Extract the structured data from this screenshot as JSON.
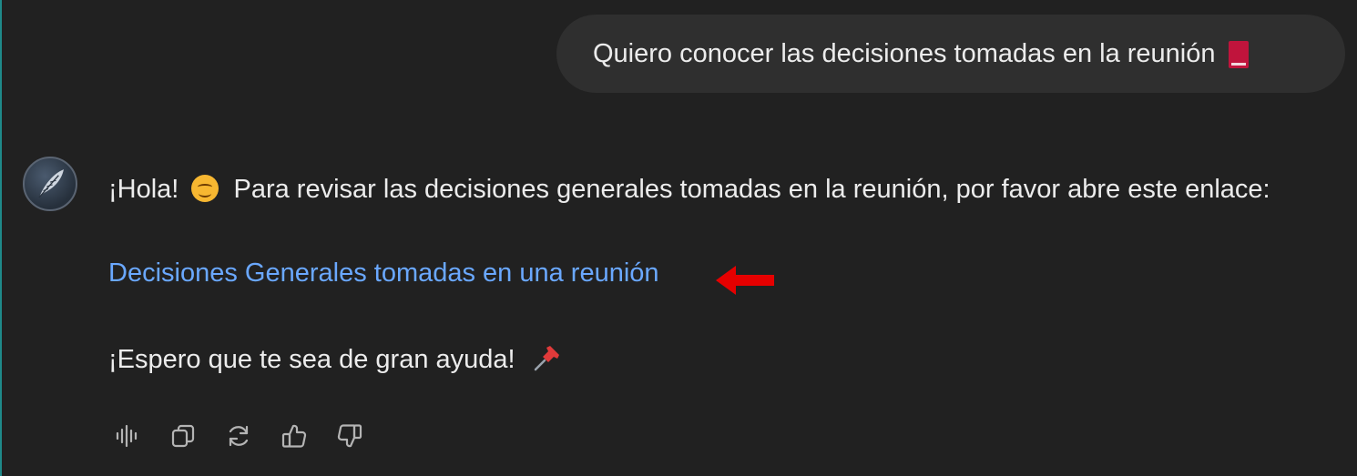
{
  "conversation": {
    "user_message": {
      "text": "Quiero conocer  las decisiones tomadas en la reunión",
      "emoji_icon": "closed-book-icon"
    },
    "assistant_message": {
      "avatar_icon": "quill-feather-icon",
      "greeting": "¡Hola!",
      "greeting_emoji": "smiling-face-icon",
      "intro": "Para revisar las decisiones generales tomadas en la reunión, por favor abre este enlace:",
      "link_text": "Decisiones Generales tomadas en una reunión",
      "closing": "¡Espero que te sea de gran ayuda!",
      "closing_emoji": "pushpin-icon"
    },
    "annotation": {
      "arrow_icon": "red-left-arrow-icon",
      "color": "#e60000"
    },
    "actions": [
      {
        "name": "read-aloud",
        "icon": "audio-waveform-icon"
      },
      {
        "name": "copy",
        "icon": "copy-icon"
      },
      {
        "name": "regenerate",
        "icon": "refresh-icon"
      },
      {
        "name": "good-response",
        "icon": "thumbs-up-icon"
      },
      {
        "name": "bad-response",
        "icon": "thumbs-down-icon"
      }
    ]
  },
  "colors": {
    "background": "#212121",
    "user_bubble": "#2f2f2f",
    "text": "#ececec",
    "link": "#6aa8ff",
    "icon": "#b4b4b4"
  }
}
